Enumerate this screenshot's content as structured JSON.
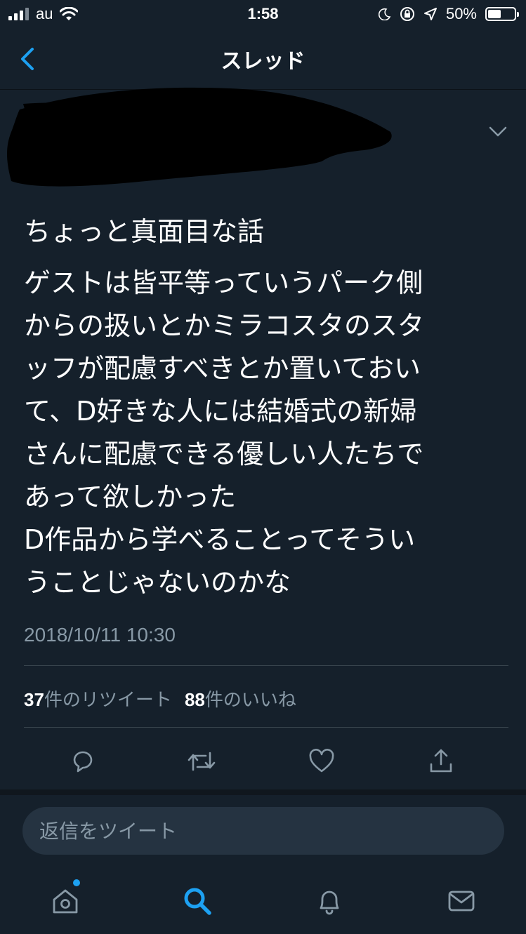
{
  "status_bar": {
    "carrier": "au",
    "time": "1:58",
    "battery_text": "50%",
    "battery_level": 0.5
  },
  "nav": {
    "title": "スレッド"
  },
  "tweet": {
    "text_lines": [
      "ちょっと真面目な話",
      "ゲストは皆平等っていうパーク側\nからの扱いとかミラコスタのスタ\nッフが配慮すべきとか置いておい\nて、D好きな人には結婚式の新婦\nさんに配慮できる優しい人たちで\nあって欲しかった\nD作品から学べることってそうい\nうことじゃないのかな"
    ],
    "timestamp": "2018/10/11 10:30",
    "retweet_count": "37",
    "retweet_label": "件のリツイート",
    "like_count": "88",
    "like_label": "件のいいね"
  },
  "reply": {
    "placeholder": "返信をツイート"
  },
  "colors": {
    "background": "#15202b",
    "accent": "#1da1f2",
    "muted": "#8899a6"
  },
  "icons": {
    "actions": [
      "reply-icon",
      "retweet-icon",
      "like-icon",
      "share-icon"
    ],
    "tabs": [
      "home-icon",
      "search-icon",
      "notifications-icon",
      "messages-icon"
    ]
  }
}
